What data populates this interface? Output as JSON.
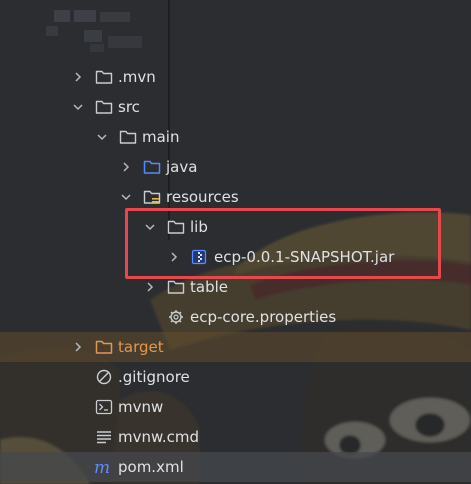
{
  "project_tree": {
    "items": [
      {
        "label": ".mvn",
        "icon": "folder-icon",
        "expanded": false
      },
      {
        "label": "src",
        "icon": "folder-icon",
        "expanded": true
      },
      {
        "label": "main",
        "icon": "folder-icon",
        "expanded": true
      },
      {
        "label": "java",
        "icon": "source-folder-icon",
        "expanded": false
      },
      {
        "label": "resources",
        "icon": "resources-folder-icon",
        "expanded": true
      },
      {
        "label": "lib",
        "icon": "folder-icon",
        "expanded": true
      },
      {
        "label": "ecp-0.0.1-SNAPSHOT.jar",
        "icon": "jar-archive-icon",
        "expanded": false
      },
      {
        "label": "table",
        "icon": "folder-icon",
        "expanded": false
      },
      {
        "label": "ecp-core.properties",
        "icon": "gear-properties-icon"
      },
      {
        "label": "target",
        "icon": "excluded-folder-icon",
        "expanded": false
      },
      {
        "label": ".gitignore",
        "icon": "ignore-file-icon"
      },
      {
        "label": "mvnw",
        "icon": "shell-script-icon"
      },
      {
        "label": "mvnw.cmd",
        "icon": "text-file-icon"
      },
      {
        "label": "pom.xml",
        "icon": "maven-icon"
      }
    ]
  },
  "colors": {
    "background": "#2b2d30",
    "text": "#dfe1e5",
    "folder_stroke": "#c9ccd1",
    "source_folder_stroke": "#548af7",
    "excluded_folder": "#e2974f",
    "highlight_box": "#e5484d",
    "maven_icon": "#5e8bff"
  }
}
